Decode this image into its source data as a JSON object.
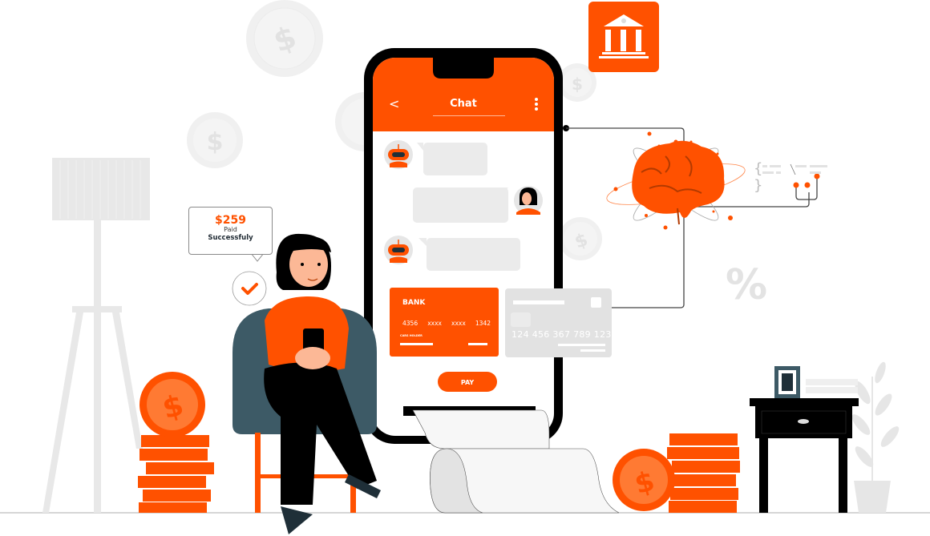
{
  "colors": {
    "accent": "#ff5100",
    "accent_light": "#ff7a33",
    "phone_frame": "#000000",
    "chair": "#3d5a66",
    "neutral_light": "#e6e6e6",
    "text_dark": "#1f2a33"
  },
  "phone": {
    "chat": {
      "back_icon": "chevron-left-icon",
      "back_glyph": "<",
      "title": "Chat",
      "menu_icon": "more-vertical-icon",
      "messages": [
        {
          "sender": "bot",
          "avatar": "robot-avatar"
        },
        {
          "sender": "user",
          "avatar": "woman-avatar"
        },
        {
          "sender": "bot",
          "avatar": "robot-avatar"
        }
      ]
    },
    "bank_card": {
      "title": "BANK",
      "number_groups": [
        "4356",
        "xxxx",
        "xxxx",
        "1342"
      ],
      "holder_label": "CARS HOLDER"
    },
    "grey_card": {
      "number": "124 456 367 789 123"
    },
    "pay_button": "PAY"
  },
  "payment_bubble": {
    "amount": "$259",
    "line1": "Paid",
    "line2": "Successfuly",
    "check_icon": "checkmark-icon"
  },
  "decor": {
    "bank_icon": "bank-building-icon",
    "brain_icon": "brain-icon",
    "percent_glyph": "%",
    "code_glyph": "{ }",
    "coin_glyph": "$"
  }
}
